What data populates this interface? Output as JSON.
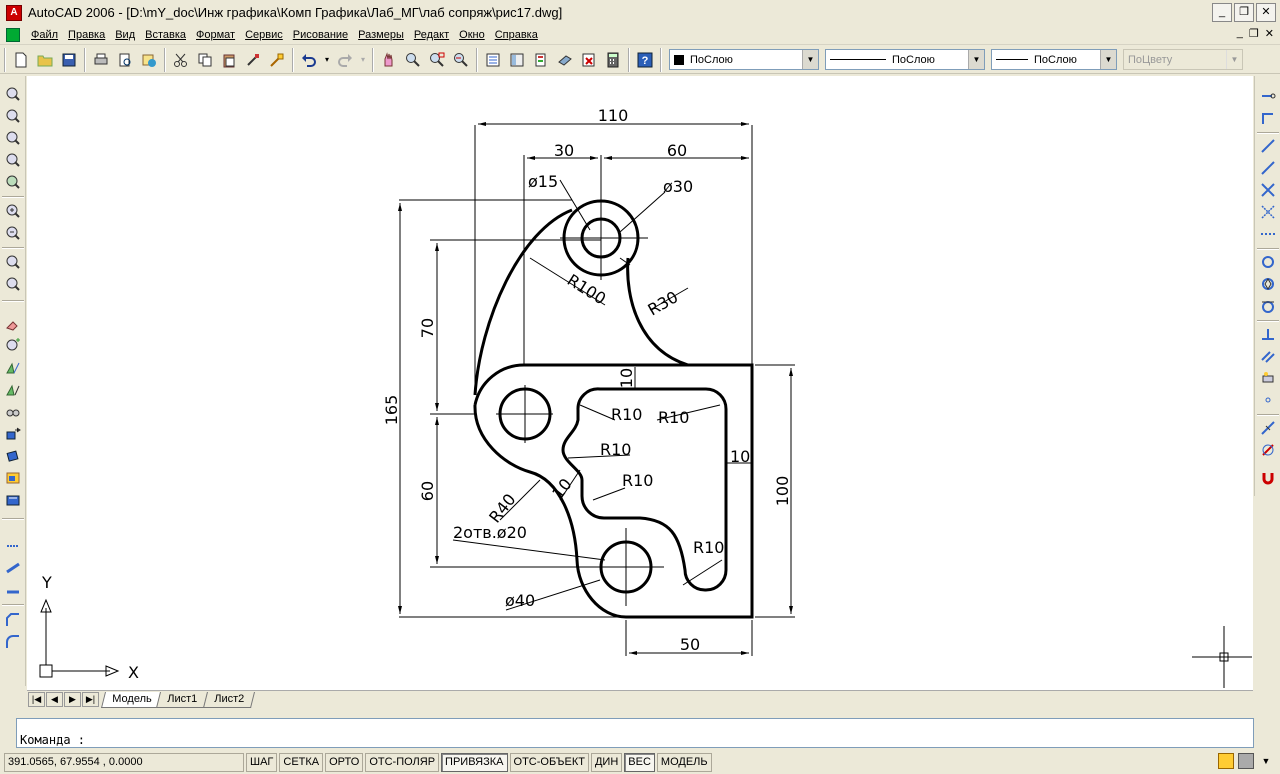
{
  "window": {
    "title": "AutoCAD 2006 - [D:\\mY_doc\\Инж графика\\Комп Графика\\Лаб_МГ\\лаб сопряж\\рис17.dwg]"
  },
  "menu": [
    "Файл",
    "Правка",
    "Вид",
    "Вставка",
    "Формат",
    "Сервис",
    "Рисование",
    "Размеры",
    "Редакт",
    "Окно",
    "Справка"
  ],
  "properties": {
    "layer": "ПоСлою",
    "linetype": "ПоСлою",
    "lineweight": "ПоСлою",
    "plotstyle": "ПоЦвету"
  },
  "drawing": {
    "dims": {
      "d110": "110",
      "d30": "30",
      "d60top": "60",
      "d15": "ø15",
      "d30dia": "ø30",
      "r100": "R100",
      "r30": "R30",
      "d70": "70",
      "d165": "165",
      "d10top": "10",
      "r10a": "R10",
      "r10b": "R10",
      "r10c": "R10",
      "d10right": "10",
      "r10d": "R10",
      "d60left": "60",
      "r40": "R40",
      "d10mid": "10",
      "holes": "2отв.ø20",
      "r10e": "R10",
      "d100": "100",
      "d40": "ø40",
      "d50": "50"
    },
    "ucs": {
      "x": "X",
      "y": "Y"
    }
  },
  "tabs": [
    "Модель",
    "Лист1",
    "Лист2"
  ],
  "command": {
    "prompt": "Команда :"
  },
  "status": {
    "coords": "391.0565, 67.9554 , 0.0000",
    "buttons": [
      "ШАГ",
      "СЕТКА",
      "ОРТО",
      "ОТС-ПОЛЯР",
      "ПРИВЯЗКА",
      "ОТС-ОБЪЕКТ",
      "ДИН",
      "ВЕС",
      "МОДЕЛЬ"
    ]
  }
}
